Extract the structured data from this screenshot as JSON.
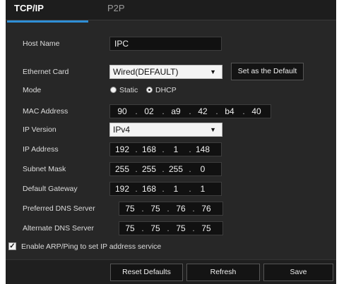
{
  "tabs": [
    {
      "label": "TCP/IP",
      "active": true
    },
    {
      "label": "P2P",
      "active": false
    }
  ],
  "host_name": {
    "label": "Host Name",
    "value": "IPC"
  },
  "ethernet_card": {
    "label": "Ethernet Card",
    "value": "Wired(DEFAULT)",
    "set_default_label": "Set as the Default"
  },
  "mode": {
    "label": "Mode",
    "static_label": "Static",
    "dhcp_label": "DHCP",
    "selected": "DHCP"
  },
  "mac_address": {
    "label": "MAC Address",
    "octets": [
      "90",
      "02",
      "a9",
      "42",
      "b4",
      "40"
    ]
  },
  "ip_version": {
    "label": "IP Version",
    "value": "IPv4"
  },
  "ip_address": {
    "label": "IP Address",
    "octets": [
      "192",
      "168",
      "1",
      "148"
    ]
  },
  "subnet_mask": {
    "label": "Subnet Mask",
    "octets": [
      "255",
      "255",
      "255",
      "0"
    ]
  },
  "default_gateway": {
    "label": "Default Gateway",
    "octets": [
      "192",
      "168",
      "1",
      "1"
    ]
  },
  "preferred_dns": {
    "label": "Preferred DNS Server",
    "octets": [
      "75",
      "75",
      "76",
      "76"
    ]
  },
  "alternate_dns": {
    "label": "Alternate DNS Server",
    "octets": [
      "75",
      "75",
      "75",
      "75"
    ]
  },
  "arp_ping": {
    "label": "Enable ARP/Ping to set IP address service",
    "checked": true
  },
  "buttons": {
    "reset": "Reset Defaults",
    "refresh": "Refresh",
    "save": "Save"
  },
  "colors": {
    "accent": "#2f8fd6",
    "panel_bg": "#272727"
  }
}
